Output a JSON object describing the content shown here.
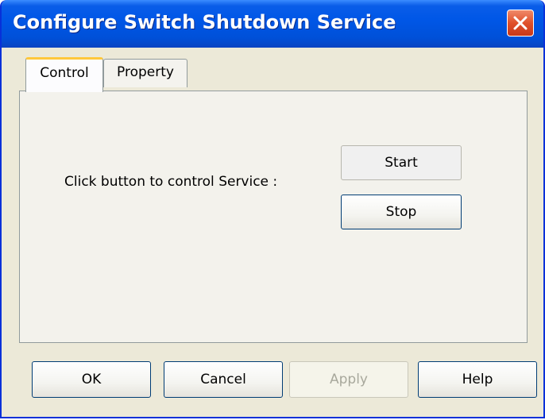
{
  "window": {
    "title": "Configure Switch Shutdown Service"
  },
  "tabs": [
    {
      "label": "Control",
      "active": true
    },
    {
      "label": "Property",
      "active": false
    }
  ],
  "control_panel": {
    "instruction": "Click button to control Service :",
    "start_label": "Start",
    "stop_label": "Stop"
  },
  "footer": {
    "ok_label": "OK",
    "cancel_label": "Cancel",
    "apply_label": "Apply",
    "help_label": "Help"
  },
  "icons": {
    "close": "close-icon"
  },
  "colors": {
    "title_bar": "#0054e3",
    "close_button": "#e0502a",
    "dialog_background": "#ece9d8",
    "active_tab_highlight": "#ffc83c",
    "disabled_text": "#a8a89c"
  }
}
